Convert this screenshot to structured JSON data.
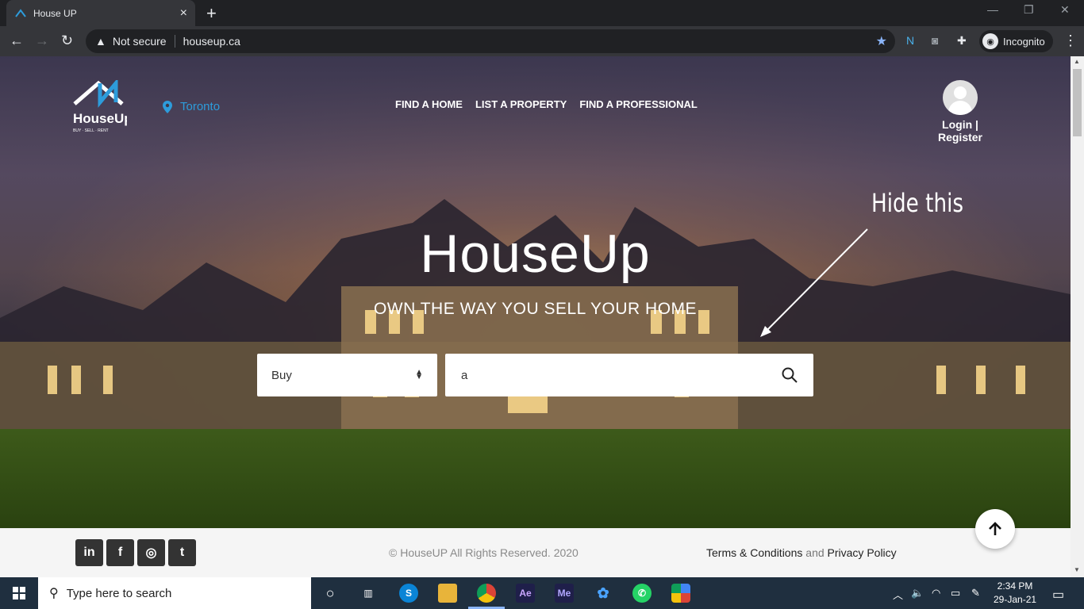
{
  "browser": {
    "tab_title": "House UP",
    "tab_close": "×",
    "new_tab": "+",
    "security_label": "Not secure",
    "url": "houseup.ca",
    "profile_label": "Incognito"
  },
  "site": {
    "location": "Toronto",
    "nav": [
      "FIND A HOME",
      "LIST A PROPERTY",
      "FIND A PROFESSIONAL"
    ],
    "login_label": "Login | Register",
    "brand": "HouseUp",
    "tagline": "OWN THE WAY YOU SELL YOUR HOME",
    "select_value": "Buy",
    "search_value": "a",
    "annotation": "Hide this"
  },
  "footer": {
    "social": [
      "in",
      "f",
      "◎",
      "t"
    ],
    "copyright": "© HouseUP All Rights Reserved. 2020",
    "terms": "Terms & Conditions",
    "and": "and",
    "privacy": "Privacy Policy"
  },
  "taskbar": {
    "search_placeholder": "Type here to search",
    "time": "2:34 PM",
    "date": "29-Jan-21"
  },
  "colors": {
    "accent": "#2d9cdb",
    "taskbar": "#1f2f3f",
    "chrome_bg": "#202124"
  }
}
